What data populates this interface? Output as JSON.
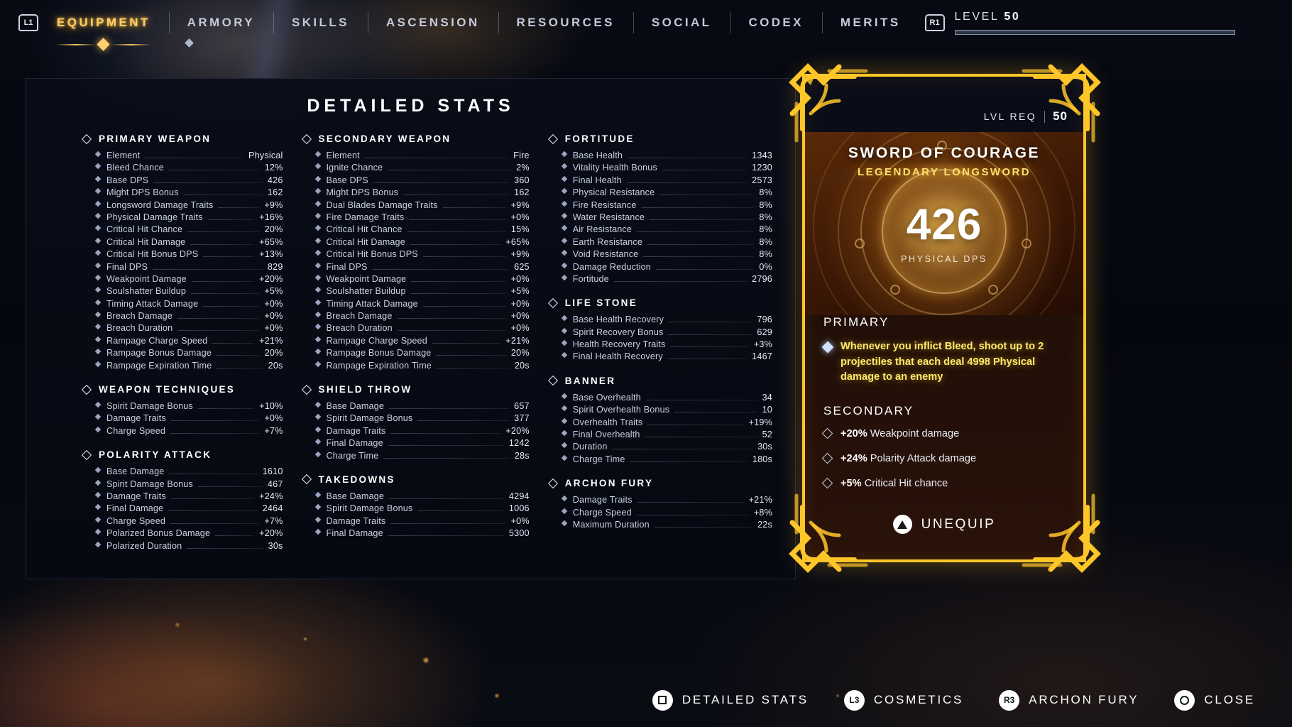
{
  "topnav": {
    "left_badge": "L1",
    "right_badge": "R1",
    "items": [
      {
        "label": "EQUIPMENT",
        "active": true
      },
      {
        "label": "ARMORY",
        "active": false
      },
      {
        "label": "SKILLS",
        "active": false
      },
      {
        "label": "ASCENSION",
        "active": false
      },
      {
        "label": "RESOURCES",
        "active": false
      },
      {
        "label": "SOCIAL",
        "active": false
      },
      {
        "label": "CODEX",
        "active": false
      },
      {
        "label": "MERITS",
        "active": false
      }
    ],
    "level_label": "LEVEL",
    "level_value": "50"
  },
  "panel": {
    "title": "DETAILED STATS",
    "columns": [
      {
        "groups": [
          {
            "title": "PRIMARY WEAPON",
            "rows": [
              {
                "label": "Element",
                "value": "Physical"
              },
              {
                "label": "Bleed Chance",
                "value": "12%"
              },
              {
                "label": "Base DPS",
                "value": "426"
              },
              {
                "label": "Might DPS Bonus",
                "value": "162"
              },
              {
                "label": "Longsword Damage Traits",
                "value": "+9%"
              },
              {
                "label": "Physical Damage Traits",
                "value": "+16%"
              },
              {
                "label": "Critical Hit Chance",
                "value": "20%"
              },
              {
                "label": "Critical Hit Damage",
                "value": "+65%"
              },
              {
                "label": "Critical Hit Bonus DPS",
                "value": "+13%"
              },
              {
                "label": "Final DPS",
                "value": "829"
              },
              {
                "label": "Weakpoint Damage",
                "value": "+20%"
              },
              {
                "label": "Soulshatter Buildup",
                "value": "+5%"
              },
              {
                "label": "Timing Attack Damage",
                "value": "+0%"
              },
              {
                "label": "Breach Damage",
                "value": "+0%"
              },
              {
                "label": "Breach Duration",
                "value": "+0%"
              },
              {
                "label": "Rampage Charge Speed",
                "value": "+21%"
              },
              {
                "label": "Rampage Bonus Damage",
                "value": "20%"
              },
              {
                "label": "Rampage Expiration Time",
                "value": "20s"
              }
            ]
          },
          {
            "title": "WEAPON TECHNIQUES",
            "rows": [
              {
                "label": "Spirit Damage Bonus",
                "value": "+10%"
              },
              {
                "label": "Damage Traits",
                "value": "+0%"
              },
              {
                "label": "Charge Speed",
                "value": "+7%"
              }
            ]
          },
          {
            "title": "POLARITY ATTACK",
            "rows": [
              {
                "label": "Base Damage",
                "value": "1610"
              },
              {
                "label": "Spirit Damage Bonus",
                "value": "467"
              },
              {
                "label": "Damage Traits",
                "value": "+24%"
              },
              {
                "label": "Final Damage",
                "value": "2464"
              },
              {
                "label": "Charge Speed",
                "value": "+7%"
              },
              {
                "label": "Polarized Bonus Damage",
                "value": "+20%"
              },
              {
                "label": "Polarized Duration",
                "value": "30s"
              }
            ]
          }
        ]
      },
      {
        "groups": [
          {
            "title": "SECONDARY WEAPON",
            "rows": [
              {
                "label": "Element",
                "value": "Fire"
              },
              {
                "label": "Ignite Chance",
                "value": "2%"
              },
              {
                "label": "Base DPS",
                "value": "360"
              },
              {
                "label": "Might DPS Bonus",
                "value": "162"
              },
              {
                "label": "Dual Blades Damage Traits",
                "value": "+9%"
              },
              {
                "label": "Fire Damage Traits",
                "value": "+0%"
              },
              {
                "label": "Critical Hit Chance",
                "value": "15%"
              },
              {
                "label": "Critical Hit Damage",
                "value": "+65%"
              },
              {
                "label": "Critical Hit Bonus DPS",
                "value": "+9%"
              },
              {
                "label": "Final DPS",
                "value": "625"
              },
              {
                "label": "Weakpoint Damage",
                "value": "+0%"
              },
              {
                "label": "Soulshatter Buildup",
                "value": "+5%"
              },
              {
                "label": "Timing Attack Damage",
                "value": "+0%"
              },
              {
                "label": "Breach Damage",
                "value": "+0%"
              },
              {
                "label": "Breach Duration",
                "value": "+0%"
              },
              {
                "label": "Rampage Charge Speed",
                "value": "+21%"
              },
              {
                "label": "Rampage Bonus Damage",
                "value": "20%"
              },
              {
                "label": "Rampage Expiration Time",
                "value": "20s"
              }
            ]
          },
          {
            "title": "SHIELD THROW",
            "rows": [
              {
                "label": "Base Damage",
                "value": "657"
              },
              {
                "label": "Spirit Damage Bonus",
                "value": "377"
              },
              {
                "label": "Damage Traits",
                "value": "+20%"
              },
              {
                "label": "Final Damage",
                "value": "1242"
              },
              {
                "label": "Charge Time",
                "value": "28s"
              }
            ]
          },
          {
            "title": "TAKEDOWNS",
            "rows": [
              {
                "label": "Base Damage",
                "value": "4294"
              },
              {
                "label": "Spirit Damage Bonus",
                "value": "1006"
              },
              {
                "label": "Damage Traits",
                "value": "+0%"
              },
              {
                "label": "Final Damage",
                "value": "5300"
              }
            ]
          }
        ]
      },
      {
        "groups": [
          {
            "title": "FORTITUDE",
            "rows": [
              {
                "label": "Base Health",
                "value": "1343"
              },
              {
                "label": "Vitality Health Bonus",
                "value": "1230"
              },
              {
                "label": "Final Health",
                "value": "2573"
              },
              {
                "label": "Physical Resistance",
                "value": "8%"
              },
              {
                "label": "Fire Resistance",
                "value": "8%"
              },
              {
                "label": "Water Resistance",
                "value": "8%"
              },
              {
                "label": "Air Resistance",
                "value": "8%"
              },
              {
                "label": "Earth Resistance",
                "value": "8%"
              },
              {
                "label": "Void Resistance",
                "value": "8%"
              },
              {
                "label": "Damage Reduction",
                "value": "0%"
              },
              {
                "label": "Fortitude",
                "value": "2796"
              }
            ]
          },
          {
            "title": "LIFE STONE",
            "rows": [
              {
                "label": "Base Health Recovery",
                "value": "796"
              },
              {
                "label": "Spirit Recovery Bonus",
                "value": "629"
              },
              {
                "label": "Health Recovery Traits",
                "value": "+3%"
              },
              {
                "label": "Final Health Recovery",
                "value": "1467"
              }
            ]
          },
          {
            "title": "BANNER",
            "rows": [
              {
                "label": "Base Overhealth",
                "value": "34"
              },
              {
                "label": "Spirit Overhealth Bonus",
                "value": "10"
              },
              {
                "label": "Overhealth Traits",
                "value": "+19%"
              },
              {
                "label": "Final Overhealth",
                "value": "52"
              },
              {
                "label": "Duration",
                "value": "30s"
              },
              {
                "label": "Charge Time",
                "value": "180s"
              }
            ]
          },
          {
            "title": "ARCHON FURY",
            "rows": [
              {
                "label": "Damage Traits",
                "value": "+21%"
              },
              {
                "label": "Charge Speed",
                "value": "+8%"
              },
              {
                "label": "Maximum Duration",
                "value": "22s"
              }
            ]
          }
        ]
      }
    ]
  },
  "card": {
    "lvl_req_label": "LVL REQ",
    "lvl_req_value": "50",
    "name": "SWORD OF COURAGE",
    "rarity": "LEGENDARY LONGSWORD",
    "dps_value": "426",
    "dps_label": "PHYSICAL DPS",
    "primary_heading": "PRIMARY",
    "primary_trait": "Whenever you inflict Bleed, shoot up to 2 projectiles that each deal 4998 Physical damage to an enemy",
    "secondary_heading": "SECONDARY",
    "secondary_traits": [
      {
        "value": "+20%",
        "text": "Weakpoint damage"
      },
      {
        "value": "+24%",
        "text": "Polarity Attack damage"
      },
      {
        "value": "+5%",
        "text": "Critical Hit chance"
      }
    ],
    "unequip_label": "UNEQUIP",
    "unequip_icon": "triangle-button-icon",
    "accent_color": "#ffc629",
    "trait_color": "#ffe96b"
  },
  "bottombar": {
    "prompts": [
      {
        "badge": "square-button-icon",
        "badge_text": "",
        "label": "DETAILED STATS"
      },
      {
        "badge": "l3-button-icon",
        "badge_text": "L3",
        "label": "COSMETICS"
      },
      {
        "badge": "r3-button-icon",
        "badge_text": "R3",
        "label": "ARCHON FURY"
      },
      {
        "badge": "circle-button-icon",
        "badge_text": "",
        "label": "CLOSE"
      }
    ]
  }
}
